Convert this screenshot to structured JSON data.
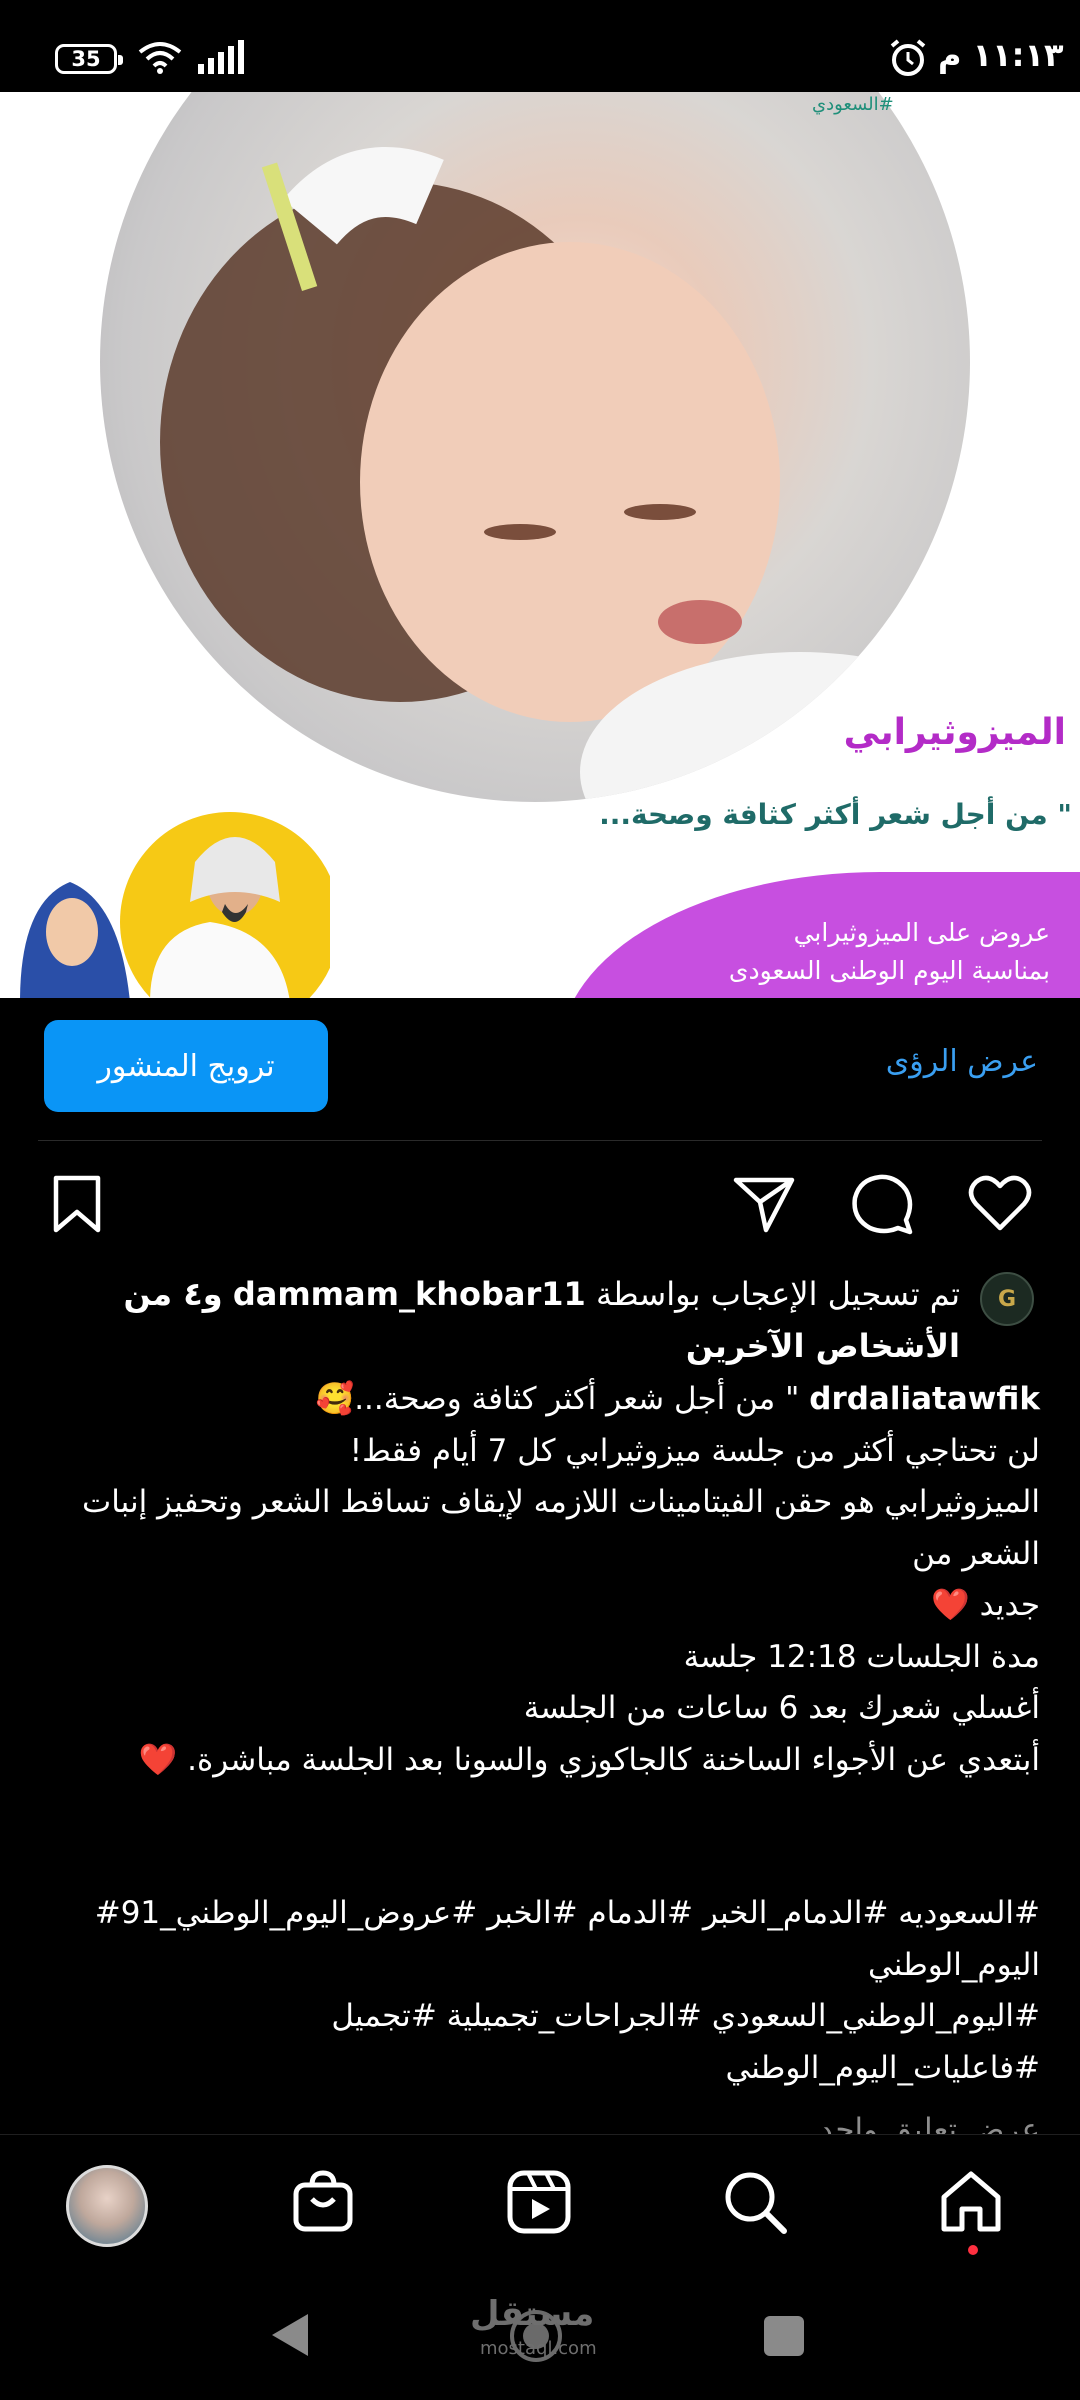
{
  "status_bar": {
    "time": "١١:١٣ م",
    "battery": "35"
  },
  "post_image": {
    "logo_text": "#السعودي",
    "title": "الميزوثيرابي",
    "subtitle": "\" من أجل شعر أكثر كثافة وصحة...",
    "offer_line1": "عروض على الميزوثيرابي",
    "offer_line2": "بمناسبة اليوم الوطنى السعودى"
  },
  "actions": {
    "promote_label": "ترويج المنشور",
    "insights_label": "عرض الرؤى"
  },
  "likes": {
    "prefix": "تم تسجيل الإعجاب بواسطة",
    "user": "dammam_khobar11",
    "suffix": "و٤ من الأشخاص الآخرين"
  },
  "caption": {
    "username": "drdaliatawfik",
    "line1": "\" من أجل شعر أكثر كثافة وصحة...🥰",
    "line2": "لن تحتاجي أكثر من جلسة ميزوثيرابي كل 7 أيام فقط!",
    "line3": "الميزوثيرابي هو حقن الفيتامينات اللازمه لإيقاف تساقط الشعر وتحفيز إنبات الشعر من",
    "line4": "جديد ❤️",
    "line5": "مدة الجلسات 12:18 جلسة",
    "line6": "أغسلي شعرك بعد 6 ساعات من الجلسة",
    "line7": "أبتعدي عن الأجواء الساخنة كالجاكوزي والسونا بعد الجلسة مباشرة. ❤️",
    "tags1": "#السعوديه #الدمام_الخبر #الدمام #الخبر #عروض_اليوم_الوطني_91# اليوم_الوطني",
    "tags2": "#اليوم_الوطني_السعودي #الجراحات_تجميلية #تجميل #فاعليات_اليوم_الوطني",
    "comments_peek": "عرض تعليق واحد"
  },
  "nav": {
    "watermark": "مستقل",
    "watermark_sub": "mostaql.com"
  },
  "colors": {
    "accent": "#0a95f6",
    "link": "#3a9ff1",
    "brand_purple": "#c74fe0"
  }
}
